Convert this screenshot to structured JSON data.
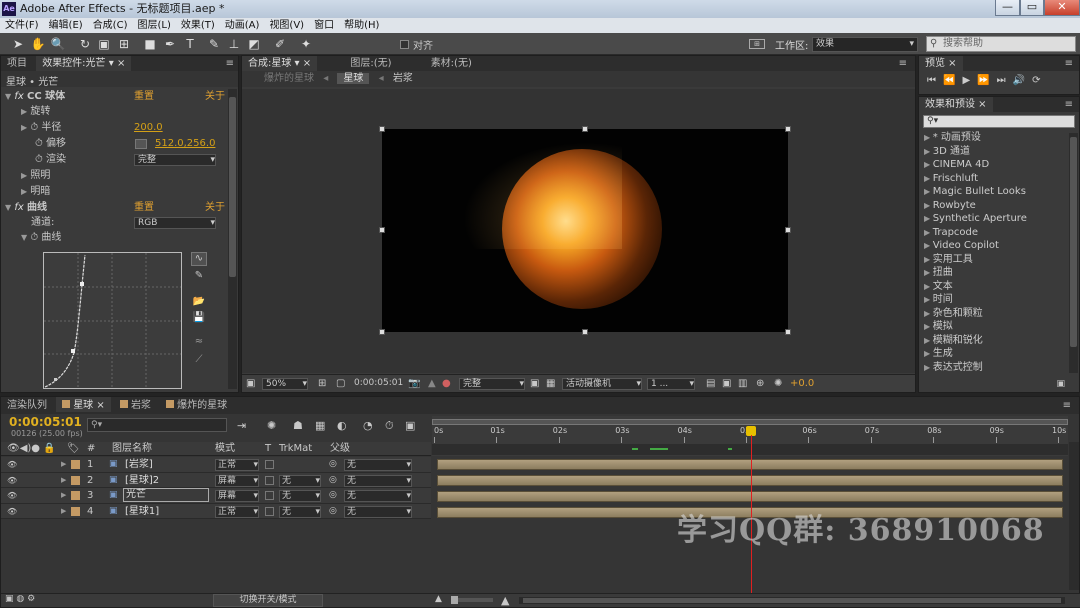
{
  "title_bar": {
    "app_icon": "Ae",
    "title": "Adobe After Effects - 无标题项目.aep *",
    "min": "—",
    "max": "▭",
    "close": "✕"
  },
  "menu": [
    "文件(F)",
    "编辑(E)",
    "合成(C)",
    "图层(L)",
    "效果(T)",
    "动画(A)",
    "视图(V)",
    "窗口",
    "帮助(H)"
  ],
  "toolbar": {
    "snap_label": "对齐",
    "workspace_label": "工作区:",
    "workspace_value": "效果",
    "search_placeholder": "搜索帮助"
  },
  "project_panel": {
    "tab_project": "项目",
    "tab_effects": "效果控件:光芒",
    "breadcrumb": "星球 • 光芒"
  },
  "effect_controls": {
    "cc_sphere": {
      "name": "CC 球体",
      "reset": "重置",
      "about": "关于"
    },
    "rotation": "旋转",
    "radius_label": "半径",
    "radius_value": "200.0",
    "offset_label": "偏移",
    "offset_value": "512.0,256.0",
    "render_label": "渲染",
    "render_value": "完整",
    "light_label": "照明",
    "shading_label": "明暗",
    "curves": {
      "name": "曲线",
      "reset": "重置",
      "about": "关于"
    },
    "channel_label": "通道:",
    "channel_value": "RGB",
    "curve_label": "曲线"
  },
  "composition_panel": {
    "tab_comp": "合成:星球",
    "tab_layer": "图层:(无)",
    "tab_footage": "素材:(无)",
    "nav": [
      "爆炸的星球",
      "星球",
      "岩浆"
    ],
    "zoom": "50%",
    "timecode": "0:00:05:01",
    "resolution": "完整",
    "camera": "活动摄像机",
    "views": "1 ...",
    "exposure": "+0.0"
  },
  "preview_panel": {
    "title": "预览"
  },
  "effects_presets": {
    "title": "效果和预设",
    "items": [
      "* 动画预设",
      "3D 通道",
      "CINEMA 4D",
      "Frischluft",
      "Magic Bullet Looks",
      "Rowbyte",
      "Synthetic Aperture",
      "Trapcode",
      "Video Copilot",
      "实用工具",
      "扭曲",
      "文本",
      "时间",
      "杂色和颗粒",
      "模拟",
      "模糊和锐化",
      "生成",
      "表达式控制"
    ]
  },
  "timeline": {
    "tabs": [
      "渲染队列",
      "星球",
      "岩浆",
      "爆炸的星球"
    ],
    "timecode": "0:00:05:01",
    "frame_info": "00126 (25.00 fps)",
    "col_num": "#",
    "col_layer_name": "图层名称",
    "col_mode": "模式",
    "col_t": "T",
    "col_trkmat": "TrkMat",
    "col_parent": "父级",
    "ruler": [
      "0s",
      "01s",
      "02s",
      "03s",
      "04s",
      "05s",
      "06s",
      "07s",
      "08s",
      "09s",
      "10s"
    ],
    "layers": [
      {
        "num": "1",
        "name": "[岩浆]",
        "mode": "正常",
        "trkmat": "",
        "parent": "无",
        "color": "#c49a64"
      },
      {
        "num": "2",
        "name": "[星球]2",
        "mode": "屏幕",
        "trkmat": "无",
        "parent": "无",
        "color": "#c49a64"
      },
      {
        "num": "3",
        "name": "光芒",
        "mode": "屏幕",
        "trkmat": "无",
        "parent": "无",
        "color": "#c49a64"
      },
      {
        "num": "4",
        "name": "[星球1]",
        "mode": "正常",
        "trkmat": "无",
        "parent": "无",
        "color": "#c49a64"
      }
    ],
    "toggle_switches": "切换开关/模式"
  },
  "watermark": "学习QQ群: 368910068"
}
